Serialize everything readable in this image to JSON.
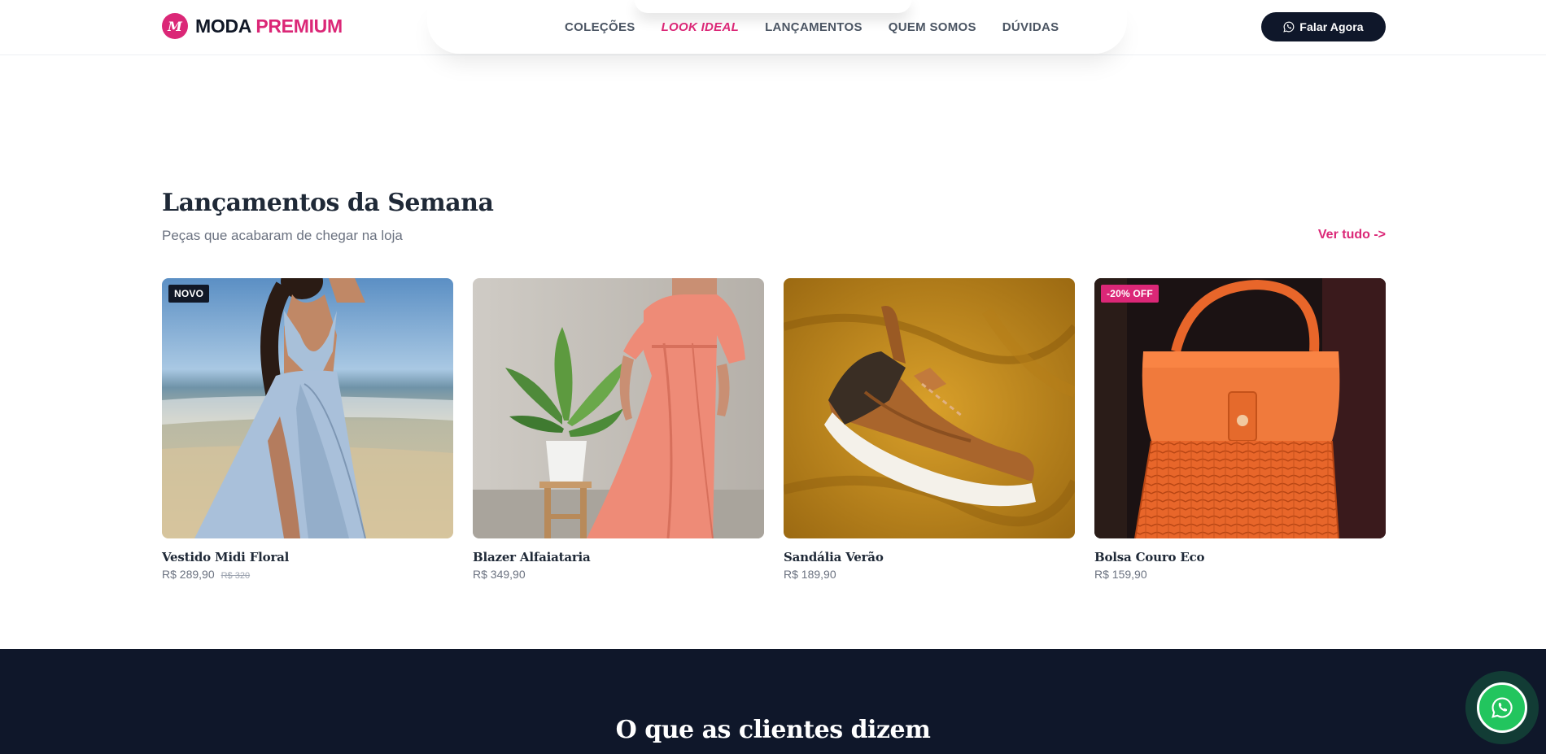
{
  "header": {
    "logo_letter": "M",
    "brand_part1": "MODA",
    "brand_part2": "PREMIUM",
    "nav": [
      {
        "label": "COLEÇÕES",
        "active": false
      },
      {
        "label": "LOOK IDEAL",
        "active": true
      },
      {
        "label": "LANÇAMENTOS",
        "active": false
      },
      {
        "label": "QUEM SOMOS",
        "active": false
      },
      {
        "label": "DÚVIDAS",
        "active": false
      }
    ],
    "cta_label": "Falar Agora",
    "cta_icon": "whatsapp-icon"
  },
  "launches": {
    "title": "Lançamentos da Semana",
    "subtitle": "Peças que acabaram de chegar na loja",
    "see_all": "Ver tudo ->",
    "products": [
      {
        "name": "Vestido Midi Floral",
        "price": "R$ 289,90",
        "old_price": "R$ 320",
        "badge": "NOVO",
        "image": "woman in light blue wrap dress on beach"
      },
      {
        "name": "Blazer Alfaiataria",
        "price": "R$ 349,90",
        "old_price": "",
        "badge": "",
        "image": "woman in coral dress next to potted plant"
      },
      {
        "name": "Sandália Verão",
        "price": "R$ 189,90",
        "old_price": "",
        "badge": "",
        "image": "brown sneaker on mustard fabric"
      },
      {
        "name": "Bolsa Couro Eco",
        "price": "R$ 159,90",
        "old_price": "",
        "badge": "-20% OFF",
        "image": "orange wicker handbag"
      }
    ]
  },
  "testimonials": {
    "title": "O que as clientes dizem"
  },
  "floating_button": {
    "icon": "whatsapp-icon"
  },
  "colors": {
    "brand_pink": "#db2777",
    "navy": "#0f172a",
    "whatsapp_green": "#22c55e"
  }
}
